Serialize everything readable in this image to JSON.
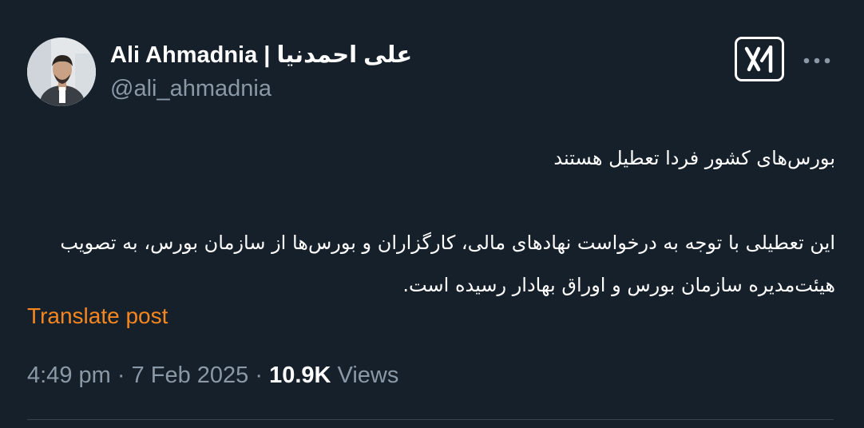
{
  "author": {
    "display_name": "Ali Ahmadnia | علی احمدنیا",
    "handle": "@ali_ahmadnia"
  },
  "actions": {
    "grok_icon": "grok-icon",
    "more_icon": "more-horizontal-icon"
  },
  "tweet": {
    "line1": "بورس‌های کشور فردا تعطیل هستند",
    "line2": "این تعطیلی با توجه به درخواست نهادهای مالی، کارگزاران و بورس‌ها از سازمان بورس، به تصویب هیئت‌مدیره سازمان بورس و اوراق بهادار رسیده است."
  },
  "translate_label": "Translate post",
  "meta": {
    "time": "4:49 pm",
    "sep1": " · ",
    "date": "7 Feb 2025",
    "sep2": " · ",
    "views_count": "10.9K",
    "views_label": " Views"
  },
  "colors": {
    "background": "#15202b",
    "secondary_text": "#8b98a5",
    "translate_link": "#f7861e"
  }
}
